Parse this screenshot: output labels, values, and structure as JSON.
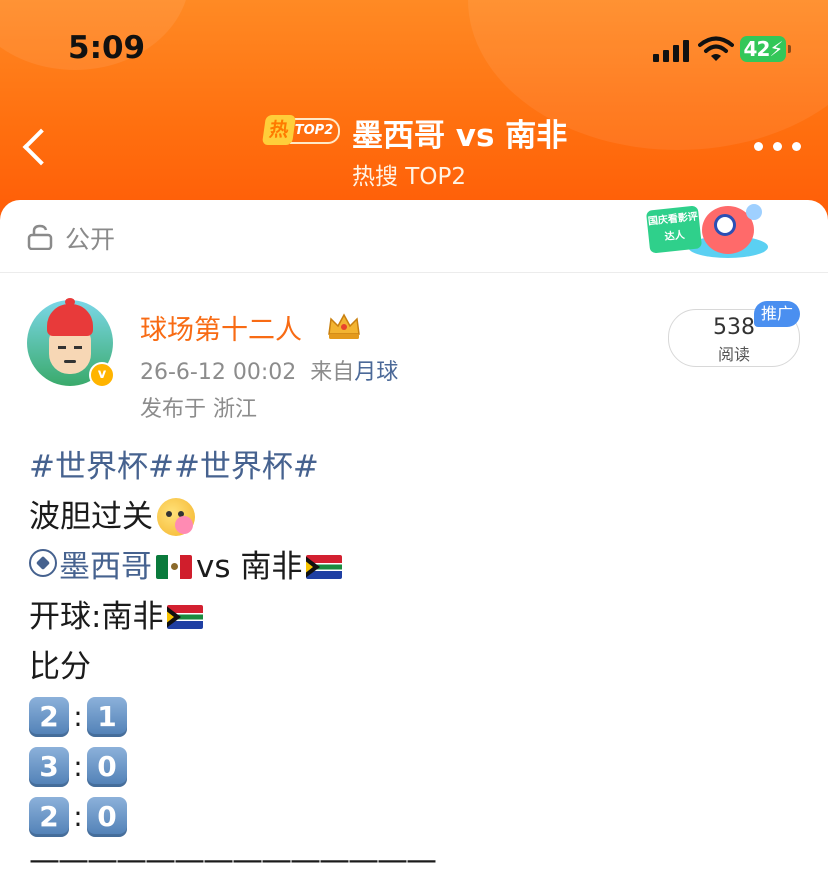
{
  "status_bar": {
    "time": "5:09",
    "battery": "42"
  },
  "header": {
    "badge_hot": "热",
    "badge_rank": "TOP2",
    "title": "墨西哥 vs 南非",
    "subtitle": "热搜 TOP2"
  },
  "visibility": {
    "label": "公开"
  },
  "mascot_text": "国庆看影评达人",
  "post": {
    "author": "球场第十二人",
    "time": "26-6-12 00:02",
    "source_prefix": "来自",
    "source": "月球",
    "location": "发布于 浙江",
    "reads": "538",
    "reads_label": "阅读",
    "promo": "推广",
    "hashtags": "#世界杯##世界杯#",
    "line_parlay": "波胆过关",
    "match_team_a": "墨西哥",
    "match_vs": "vs",
    "match_team_b": "南非",
    "kickoff": "开球:南非",
    "score_label": "比分",
    "scores": [
      {
        "home": "2",
        "away": "1"
      },
      {
        "home": "3",
        "away": "0"
      },
      {
        "home": "2",
        "away": "0"
      }
    ],
    "divider": "——————————————"
  },
  "icons": [
    "back-arrow-icon",
    "more-icon",
    "lock-icon",
    "verified-icon",
    "crown-icon",
    "soccer-ball-icon",
    "mexico-flag-icon",
    "south-africa-flag-icon"
  ],
  "colors": {
    "header": "#ff6f0f",
    "author": "#f86b14",
    "link": "#46628f",
    "promo": "#4a8ff0"
  }
}
